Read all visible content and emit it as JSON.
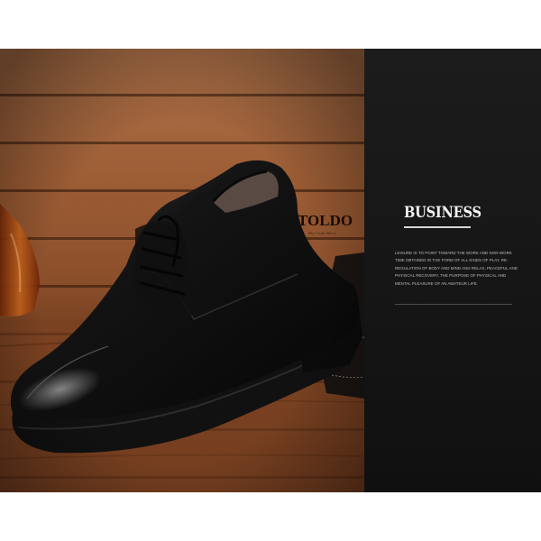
{
  "logo": {
    "main": "TOLDO",
    "sub": "Shy Crafts Shoes"
  },
  "panel": {
    "heading": "BUSINESS",
    "body": "Leisure is to point toward the work and non-work time obtained in the form of all kinds of play, re-regulation of body and mind and relax, peaceful and physical recovery, the purpose of physical and mental pleasure of an amateur life."
  },
  "colors": {
    "panel_background": "#151515",
    "wood": "#8c4f2b",
    "shoe_leather": "#0e0e0e",
    "heading_text": "#f2f2f2"
  }
}
